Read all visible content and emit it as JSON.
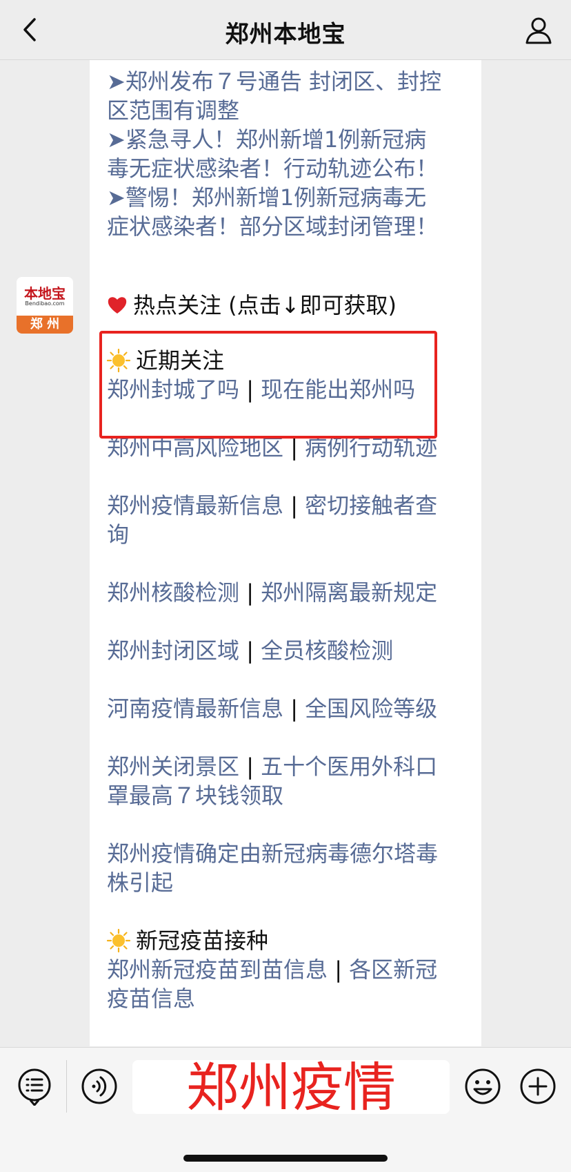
{
  "header": {
    "title": "郑州本地宝"
  },
  "bubble1": {
    "lines": [
      "➤郑州发布７号通告 封闭区、封控",
      "区范围有调整",
      "➤紧急寻人！郑州新增1例新冠病",
      "毒无症状感染者！行动轨迹公布！",
      "➤警惕！郑州新增1例新冠病毒无",
      "症状感染者！部分区域封闭管理！"
    ]
  },
  "avatar": {
    "logo_text": "本地宝",
    "url_text": "Bendibao.com",
    "city": "郑 州"
  },
  "bubble2": {
    "hot_title": "热点关注 (点击↓即可获取)",
    "recent_title": "近期关注",
    "links": [
      {
        "a": "郑州封城了吗",
        "b": "现在能出郑州吗"
      },
      {
        "a": "郑州中高风险地区",
        "b": "病例行动轨迹"
      },
      {
        "a": "郑州疫情最新信息",
        "b": "密切接触者查",
        "b2": "询"
      },
      {
        "a": "郑州核酸检测",
        "b": "郑州隔离最新规定"
      },
      {
        "a": "郑州封闭区域",
        "b": "全员核酸检测"
      },
      {
        "a": "河南疫情最新信息",
        "b": "全国风险等级"
      },
      {
        "a": "郑州关闭景区",
        "b": "五十个医用外科口",
        "b2": "罩最高７块钱领取"
      },
      {
        "single1": "郑州疫情确定由新冠病毒德尔塔毒",
        "single2": "株引起"
      }
    ],
    "vaccine_title": "新冠疫苗接种",
    "vaccine_link": {
      "a": "郑州新冠疫苗到苗信息",
      "b": "各区新冠",
      "b2": "疫苗信息"
    },
    "separator": "|"
  },
  "bottom": {
    "input_text": "郑州疫情"
  },
  "colors": {
    "link": "#576b95",
    "highlight": "#e8231f"
  }
}
